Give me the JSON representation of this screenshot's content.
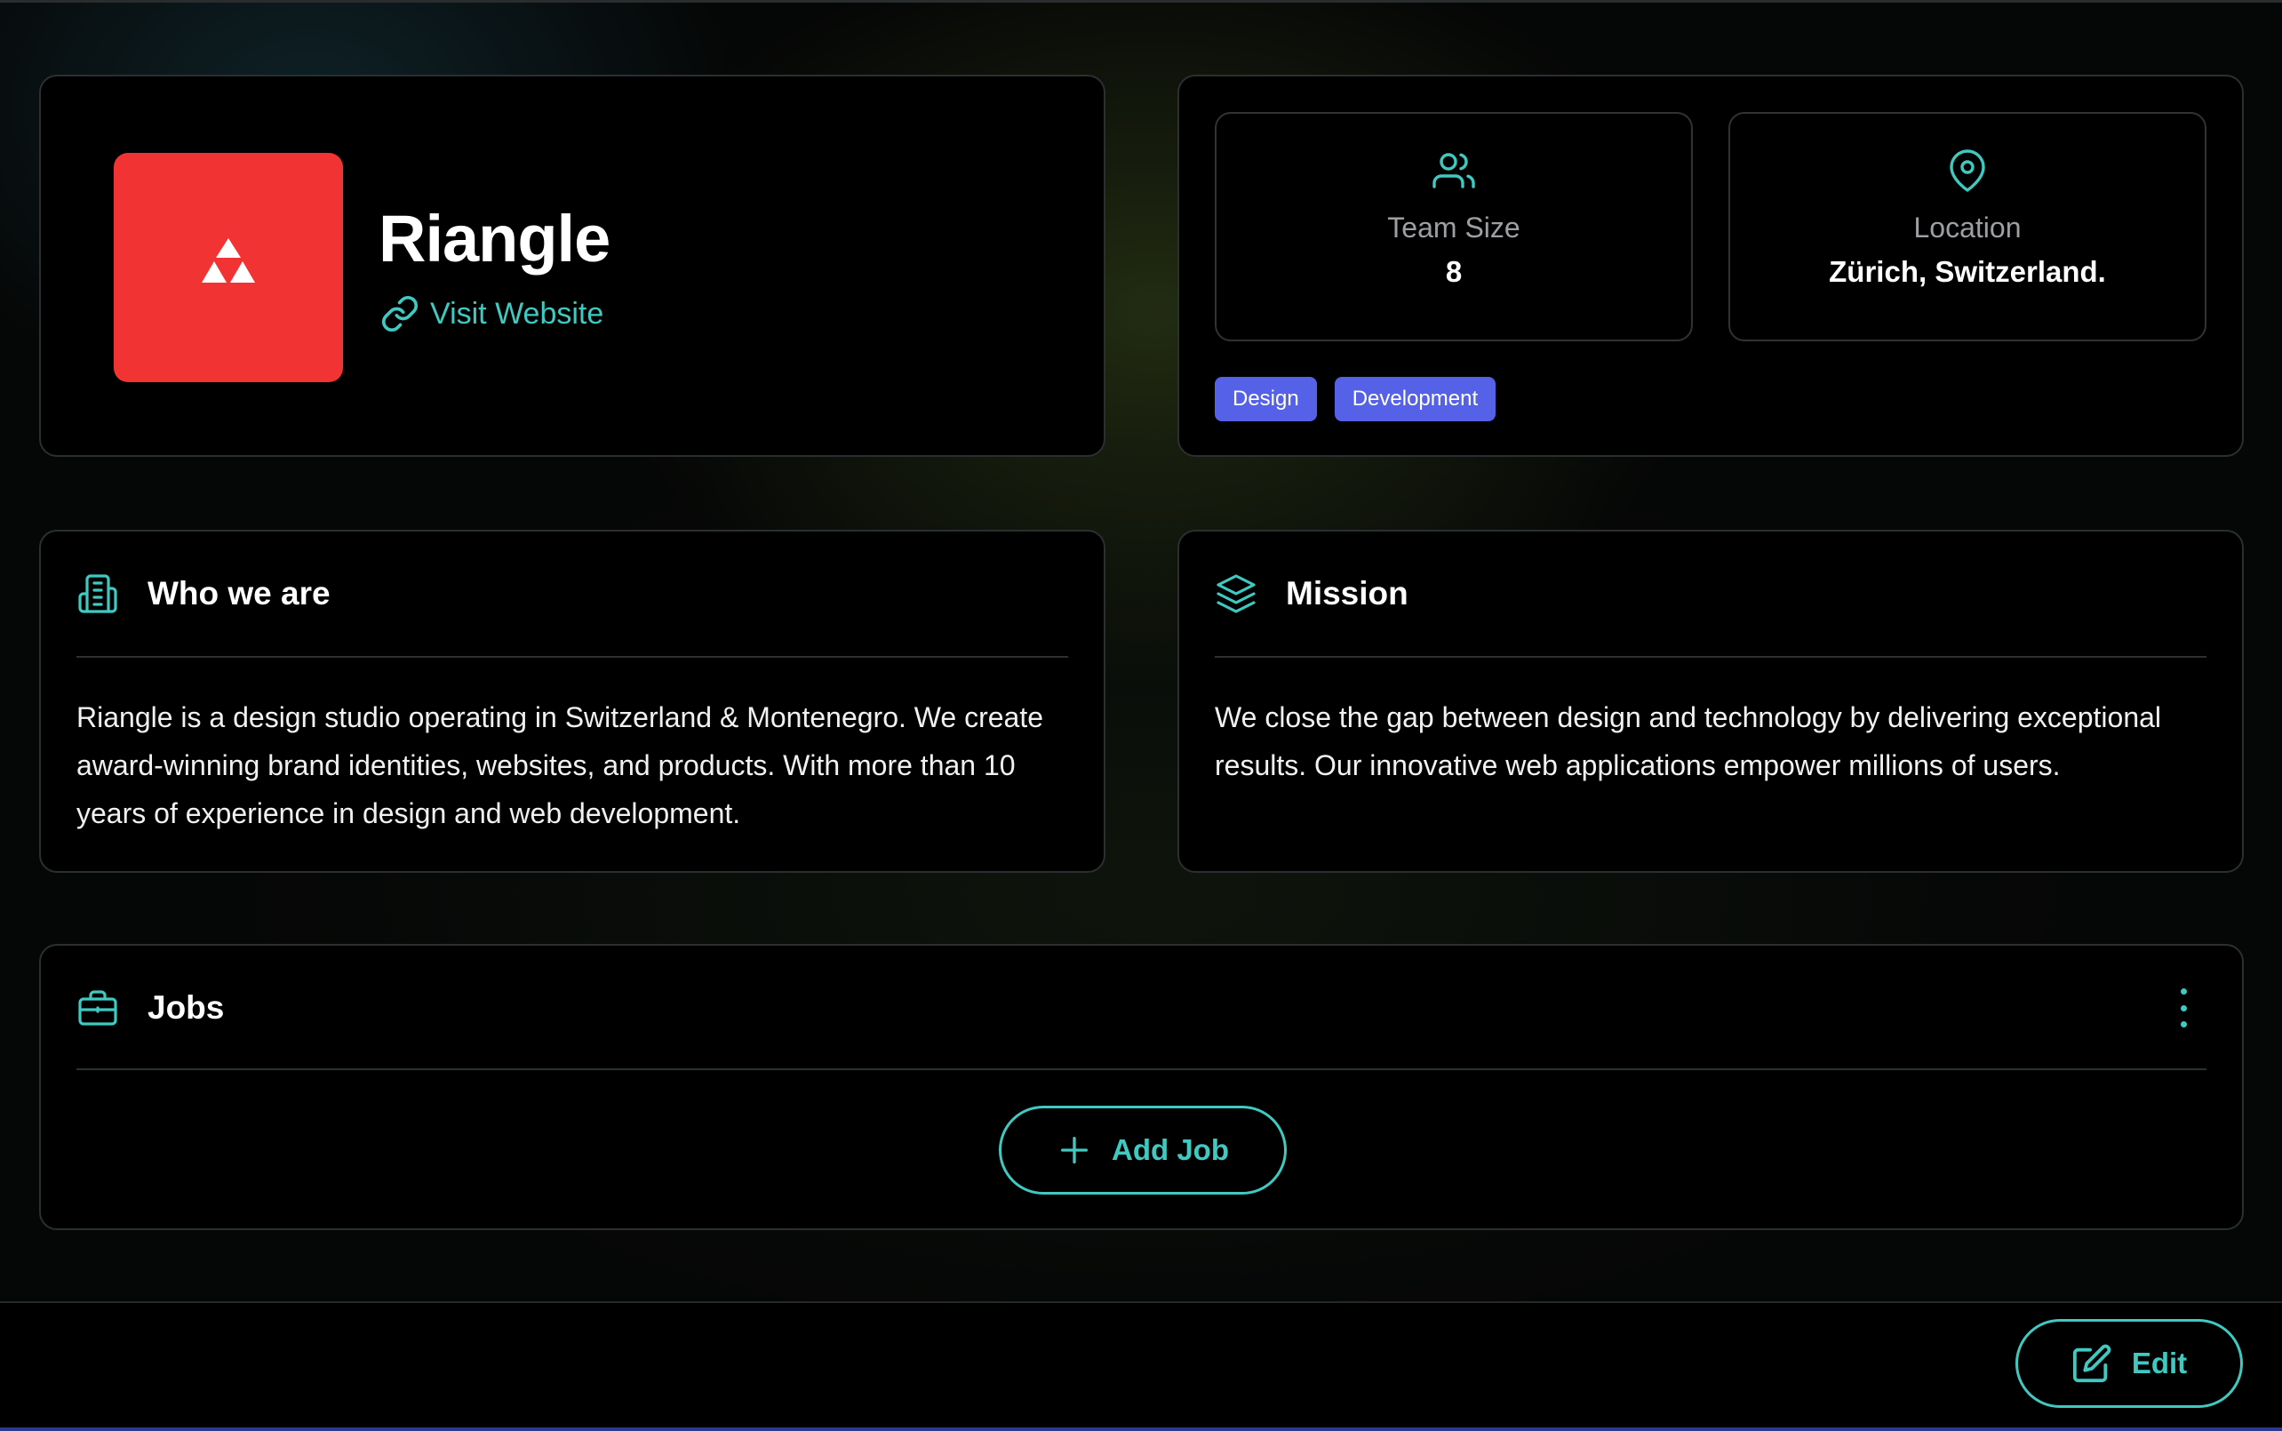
{
  "company": {
    "name": "Riangle",
    "website_label": "Visit Website",
    "logo_color": "#f23333"
  },
  "stats": {
    "team_size_label": "Team Size",
    "team_size_value": "8",
    "location_label": "Location",
    "location_value": "Zürich, Switzerland."
  },
  "tags": [
    "Design",
    "Development"
  ],
  "who_we_are": {
    "title": "Who we are",
    "body": "Riangle is a design studio operating in Switzerland & Montenegro. We create award-winning brand identities, websites, and products. With more than 10 years of experience in design and web development."
  },
  "mission": {
    "title": "Mission",
    "body": "We close the gap between design and technology by delivering exceptional results. Our innovative web applications empower millions of users."
  },
  "jobs": {
    "title": "Jobs",
    "add_label": "Add Job"
  },
  "footer": {
    "edit_label": "Edit"
  },
  "colors": {
    "accent": "#3fc9c1",
    "tag": "#5561e6",
    "card_bg": "#000000",
    "border": "#2b2f30"
  },
  "icons": {
    "website": "link-icon",
    "team": "users-icon",
    "location": "map-pin-icon",
    "who": "building-icon",
    "mission": "layers-icon",
    "jobs": "briefcase-icon",
    "menu": "more-vertical-icon",
    "add": "plus-icon",
    "edit": "edit-icon"
  }
}
